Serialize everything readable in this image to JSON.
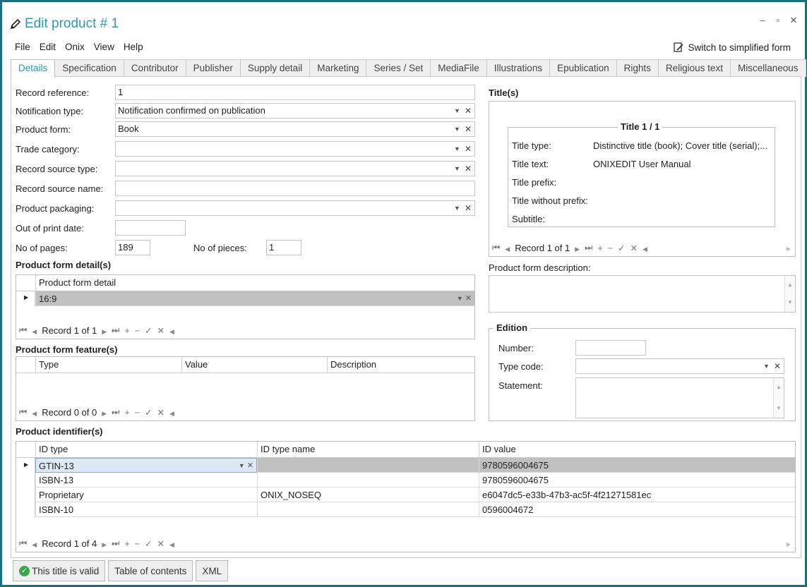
{
  "window": {
    "title": "Edit product # 1",
    "controls": [
      "–",
      "▫",
      "✕"
    ]
  },
  "menu": [
    "File",
    "Edit",
    "Onix",
    "View",
    "Help"
  ],
  "simplified_label": "Switch to simplified form",
  "tabs": [
    "Details",
    "Specification",
    "Contributor",
    "Publisher",
    "Supply detail",
    "Marketing",
    "Series / Set",
    "MediaFile",
    "Illustrations",
    "Epublication",
    "Rights",
    "Religious text",
    "Miscellaneous"
  ],
  "form": {
    "record_reference": {
      "label": "Record reference:",
      "value": "1"
    },
    "notification_type": {
      "label": "Notification type:",
      "value": "Notification confirmed on publication"
    },
    "product_form": {
      "label": "Product form:",
      "value": "Book"
    },
    "trade_category": {
      "label": "Trade category:",
      "value": ""
    },
    "record_source_type": {
      "label": "Record source type:",
      "value": ""
    },
    "record_source_name": {
      "label": "Record source name:",
      "value": ""
    },
    "product_packaging": {
      "label": "Product packaging:",
      "value": ""
    },
    "out_of_print_date": {
      "label": "Out of print date:",
      "value": ""
    },
    "no_of_pages": {
      "label": "No of pages:",
      "value": "189"
    },
    "no_of_pieces": {
      "label": "No of pieces:",
      "value": "1"
    }
  },
  "product_form_detail": {
    "heading": "Product form detail(s)",
    "column": "Product form detail",
    "rows": [
      "16:9"
    ],
    "nav": "Record 1 of 1"
  },
  "product_form_feature": {
    "heading": "Product form feature(s)",
    "columns": [
      "Type",
      "Value",
      "Description"
    ],
    "nav": "Record 0 of 0"
  },
  "product_identifiers": {
    "heading": "Product identifier(s)",
    "columns": [
      "ID type",
      "ID type name",
      "ID value"
    ],
    "rows": [
      [
        "GTIN-13",
        "",
        "9780596004675"
      ],
      [
        "ISBN-13",
        "",
        "9780596004675"
      ],
      [
        "Proprietary",
        "ONIX_NOSEQ",
        "e6047dc5-e33b-47b3-ac5f-4f21271581ec"
      ],
      [
        "ISBN-10",
        "",
        "0596004672"
      ]
    ],
    "nav": "Record 1 of 4"
  },
  "titles": {
    "heading": "Title(s)",
    "legend": "Title 1 / 1",
    "fields": [
      {
        "label": "Title type:",
        "value": "Distinctive title (book); Cover title (serial);..."
      },
      {
        "label": "Title text:",
        "value": "ONIXEDIT User Manual"
      },
      {
        "label": "Title prefix:",
        "value": ""
      },
      {
        "label": "Title without prefix:",
        "value": ""
      },
      {
        "label": "Subtitle:",
        "value": ""
      }
    ],
    "nav": "Record 1 of 1"
  },
  "product_form_description": {
    "label": "Product form description:"
  },
  "edition": {
    "legend": "Edition",
    "number_label": "Number:",
    "type_code_label": "Type code:",
    "statement_label": "Statement:"
  },
  "buttons": {
    "valid": "This title is valid",
    "toc": "Table of contents",
    "xml": "XML"
  }
}
